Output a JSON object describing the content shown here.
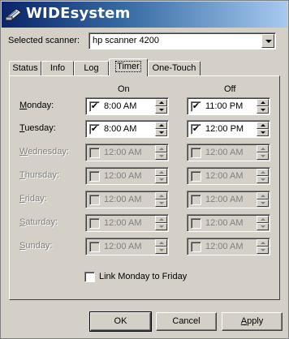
{
  "window": {
    "title": "WIDEsystem",
    "logo_icon": "scanner-logo-icon"
  },
  "scanner": {
    "label": "Selected scanner:",
    "value": "hp scanner 4200"
  },
  "tabs": [
    {
      "label": "Status",
      "active": false
    },
    {
      "label": "Info",
      "active": false
    },
    {
      "label": "Log",
      "active": false
    },
    {
      "label": "Timer",
      "active": true
    },
    {
      "label": "One-Touch",
      "active": false
    }
  ],
  "timer": {
    "on_header": "On",
    "off_header": "Off",
    "days": [
      {
        "label": "Monday",
        "underline": "M",
        "rest": "onday:",
        "enabled": true,
        "on": {
          "checked": true,
          "time": "8:00 AM"
        },
        "off": {
          "checked": true,
          "time": "11:00 PM"
        }
      },
      {
        "label": "Tuesday",
        "underline": "T",
        "rest": "uesday:",
        "enabled": true,
        "on": {
          "checked": true,
          "time": "8:00 AM"
        },
        "off": {
          "checked": true,
          "time": "12:00 PM"
        }
      },
      {
        "label": "Wednesday",
        "underline": "W",
        "rest": "ednesday:",
        "enabled": false,
        "on": {
          "checked": false,
          "time": "12:00 AM"
        },
        "off": {
          "checked": false,
          "time": "12:00 AM"
        }
      },
      {
        "label": "Thursday",
        "underline": "T",
        "rest": "hursday:",
        "enabled": false,
        "on": {
          "checked": false,
          "time": "12:00 AM"
        },
        "off": {
          "checked": false,
          "time": "12:00 AM"
        }
      },
      {
        "label": "Friday",
        "underline": "F",
        "rest": "riday:",
        "enabled": false,
        "on": {
          "checked": false,
          "time": "12:00 AM"
        },
        "off": {
          "checked": false,
          "time": "12:00 AM"
        }
      },
      {
        "label": "Saturday",
        "underline": "S",
        "rest": "aturday:",
        "enabled": false,
        "on": {
          "checked": false,
          "time": "12:00 AM"
        },
        "off": {
          "checked": false,
          "time": "12:00 AM"
        }
      },
      {
        "label": "Sunday",
        "underline": "S",
        "rest": "unday:",
        "enabled": false,
        "on": {
          "checked": false,
          "time": "12:00 AM"
        },
        "off": {
          "checked": false,
          "time": "12:00 AM"
        }
      }
    ],
    "link_label": "Link Monday to Friday",
    "link_checked": false
  },
  "buttons": {
    "ok": "OK",
    "cancel": "Cancel",
    "apply": "Apply",
    "apply_underline": "A",
    "apply_rest": "pply"
  }
}
